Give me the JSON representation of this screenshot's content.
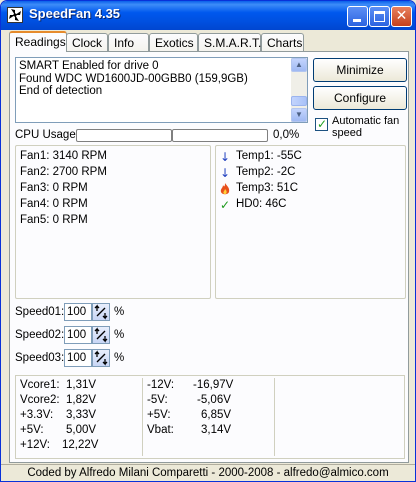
{
  "window": {
    "title": "SpeedFan 4.35",
    "title_bar_color": "#0054e3"
  },
  "tabs": [
    {
      "label": "Readings",
      "active": true
    },
    {
      "label": "Clock",
      "active": false
    },
    {
      "label": "Info",
      "active": false
    },
    {
      "label": "Exotics",
      "active": false
    },
    {
      "label": "S.M.A.R.T.",
      "active": false
    },
    {
      "label": "Charts",
      "active": false
    }
  ],
  "log": {
    "lines": [
      "SMART Enabled for drive 0",
      "Found WDC WD1600JD-00GBB0 (159,9GB)",
      "End of detection"
    ]
  },
  "buttons": {
    "minimize": "Minimize",
    "configure": "Configure"
  },
  "auto_fan": {
    "label": "Automatic fan speed",
    "checked": true
  },
  "cpu_usage": {
    "label": "CPU Usage",
    "value": "0,0%",
    "level": 0
  },
  "fans": [
    "Fan1: 3140 RPM",
    "Fan2: 2700 RPM",
    "Fan3: 0 RPM",
    "Fan4: 0 RPM",
    "Fan5: 0 RPM"
  ],
  "temps": [
    {
      "label": "Temp1: -55C",
      "icon": "arrow-down-icon",
      "color": "#1f3fbf"
    },
    {
      "label": "Temp2: -2C",
      "icon": "arrow-down-icon",
      "color": "#1f3fbf"
    },
    {
      "label": "Temp3: 51C",
      "icon": "flame-icon",
      "color": "#e0401a"
    },
    {
      "label": "HD0:    46C",
      "icon": "checkmark-icon",
      "color": "#1d9a1d"
    }
  ],
  "speeds": [
    {
      "label": "Speed01:",
      "value": "100",
      "unit": "%"
    },
    {
      "label": "Speed02:",
      "value": "100",
      "unit": "%"
    },
    {
      "label": "Speed03:",
      "value": "100",
      "unit": "%"
    }
  ],
  "voltages_left": [
    {
      "name": "Vcore1:",
      "value": "1,31V"
    },
    {
      "name": "Vcore2:",
      "value": "1,82V"
    },
    {
      "name": "+3.3V:",
      "value": "3,33V"
    },
    {
      "name": "+5V:",
      "value": "5,00V"
    },
    {
      "name": "+12V:",
      "value": "12,22V"
    }
  ],
  "voltages_right": [
    {
      "name": "-12V:",
      "value": "-16,97V"
    },
    {
      "name": "-5V:",
      "value": "-5,06V"
    },
    {
      "name": "+5V:",
      "value": "6,85V"
    },
    {
      "name": "Vbat:",
      "value": "3,14V"
    }
  ],
  "status_bar": "Coded by Alfredo Milani Comparetti - 2000-2008 - alfredo@almico.com"
}
